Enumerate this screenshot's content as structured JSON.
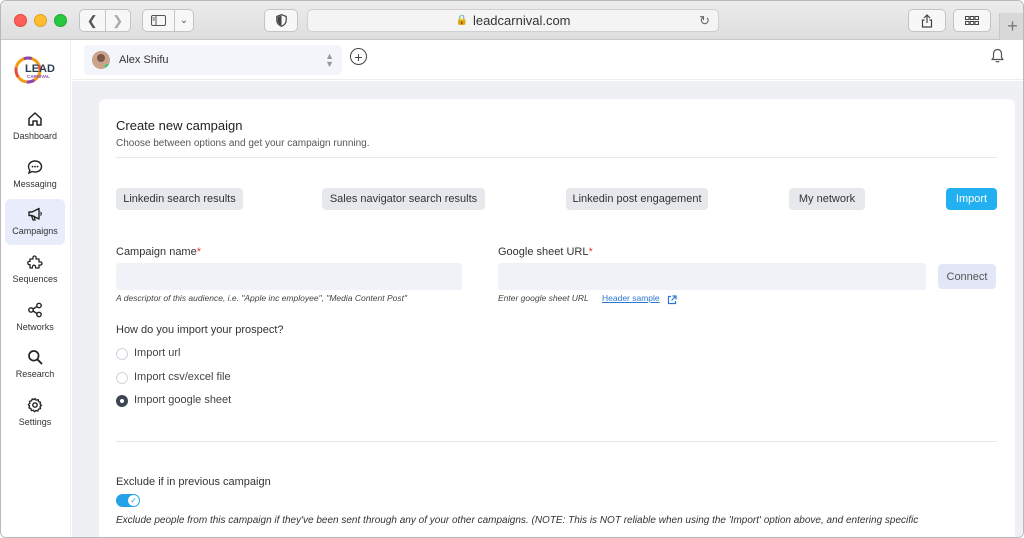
{
  "browser": {
    "url": "leadcarnival.com"
  },
  "logo": {
    "text": "LEAD",
    "subtext": "CARNIVAL"
  },
  "sidebar": {
    "items": [
      {
        "label": "Dashboard",
        "icon": "home-icon"
      },
      {
        "label": "Messaging",
        "icon": "chat-icon"
      },
      {
        "label": "Campaigns",
        "icon": "megaphone-icon",
        "active": true
      },
      {
        "label": "Sequences",
        "icon": "puzzle-icon"
      },
      {
        "label": "Networks",
        "icon": "share-icon"
      },
      {
        "label": "Research",
        "icon": "search-icon"
      },
      {
        "label": "Settings",
        "icon": "gear-icon"
      }
    ]
  },
  "appbar": {
    "user_name": "Alex Shifu"
  },
  "campaign": {
    "title": "Create new campaign",
    "subtitle": "Choose between options and get your campaign running.",
    "options": [
      "Linkedin search results",
      "Sales navigator search results",
      "Linkedin post engagement",
      "My network",
      "Import"
    ],
    "name_label": "Campaign name",
    "name_value": "",
    "name_hint": "A descriptor of this audience, i.e. \"Apple inc employee\", \"Media Content Post\"",
    "sheet_label": "Google sheet URL",
    "sheet_value": "",
    "sheet_hint": "Enter google sheet URL",
    "sheet_link": "Header sample",
    "connect_label": "Connect",
    "import_question": "How do you import your prospect?",
    "import_options": [
      {
        "label": "Import url",
        "checked": false
      },
      {
        "label": "Import csv/excel file",
        "checked": false
      },
      {
        "label": "Import google sheet",
        "checked": true
      }
    ],
    "exclude_label": "Exclude if in previous campaign",
    "exclude_enabled": true,
    "exclude_note": "Exclude people from this campaign if they've been sent through any of your other campaigns. (NOTE: This is NOT reliable when using the 'Import' option above, and entering specific"
  },
  "colors": {
    "accent": "#23b0f0",
    "required": "#e53935",
    "active_nav": "#e8ecfb"
  }
}
